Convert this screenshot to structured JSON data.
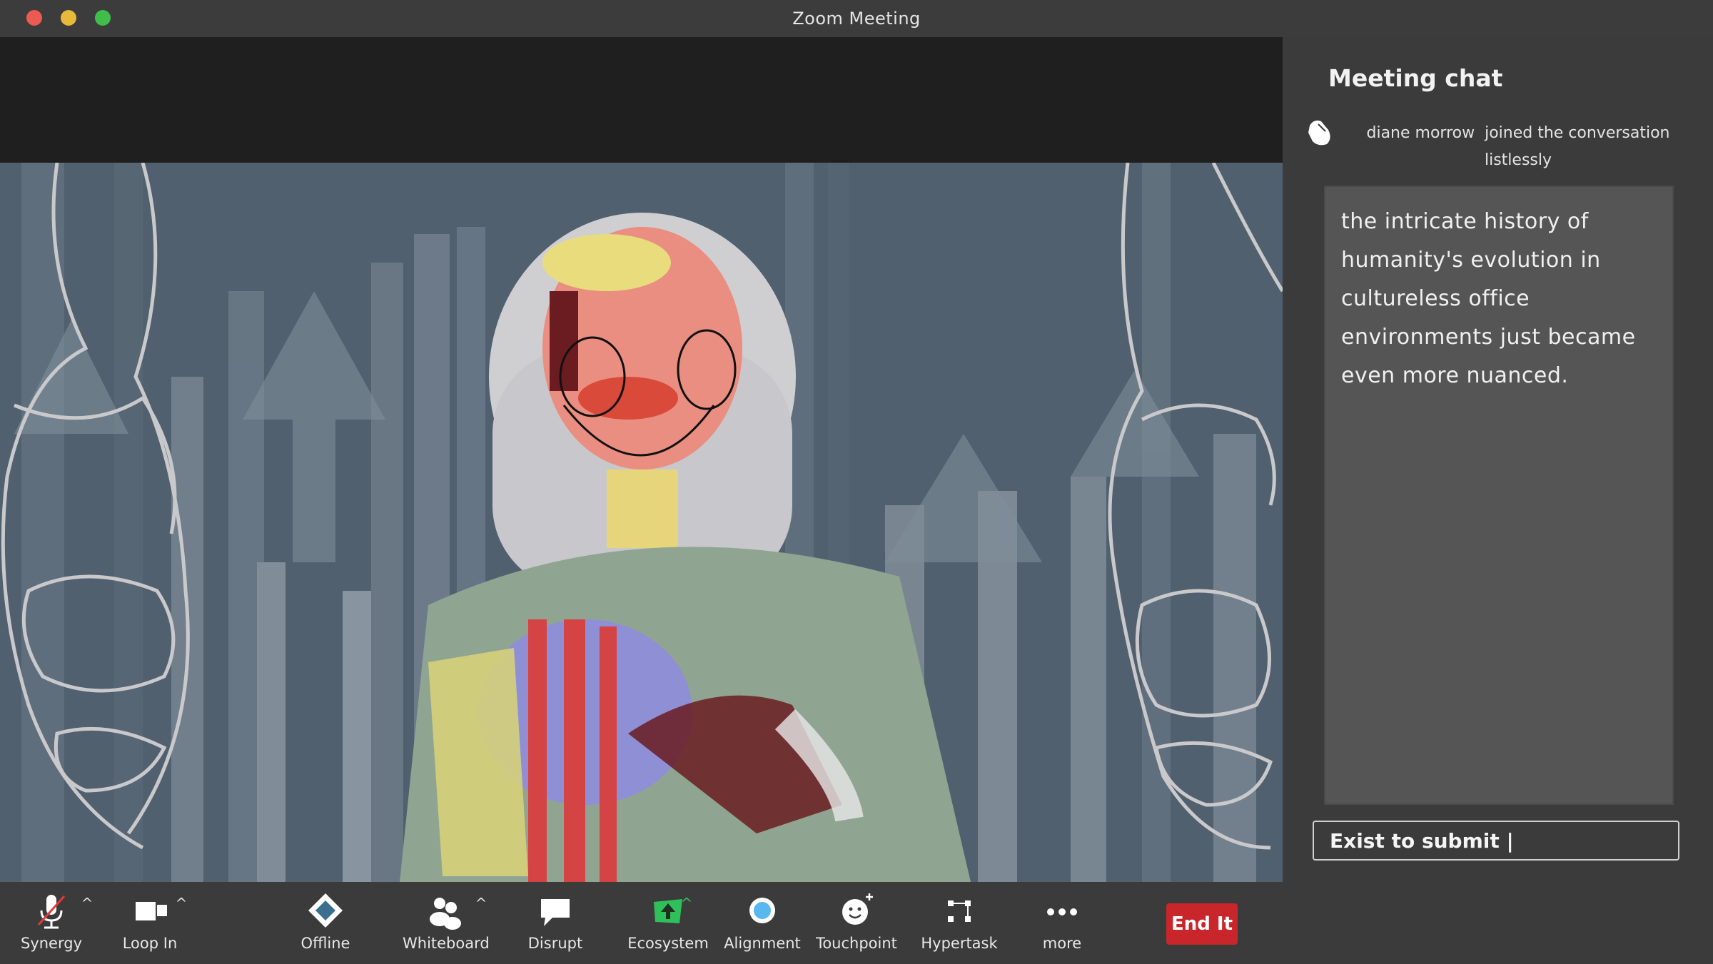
{
  "window": {
    "title": "Zoom Meeting"
  },
  "chat": {
    "title": "Meeting chat",
    "join_name": "diane morrow",
    "join_text": "joined the conversation listlessly",
    "message": "the intricate history of humanity's evolution in cultureless office environments just became even more nuanced.",
    "input_placeholder": "Exist to submit |"
  },
  "toolbar": {
    "synergy": "Synergy",
    "loop_in": "Loop In",
    "offline": "Offline",
    "whiteboard": "Whiteboard",
    "disrupt": "Disrupt",
    "ecosystem": "Ecosystem",
    "alignment": "Alignment",
    "touchpoint": "Touchpoint",
    "hypertask": "Hypertask",
    "more": "more",
    "end": "End It"
  },
  "colors": {
    "end_button": "#c8262b",
    "ecosystem_icon": "#2fbf5b",
    "alignment_icon": "#59b8f0"
  },
  "icons": {
    "synergy": "muted-microphone-icon",
    "loop_in": "video-camera-icon",
    "offline": "share-diamond-icon",
    "whiteboard": "participants-icon",
    "disrupt": "speech-bubble-icon",
    "ecosystem": "share-up-arrow-icon",
    "alignment": "record-circle-icon",
    "touchpoint": "smiley-plus-icon",
    "hypertask": "apps-icon",
    "more": "ellipsis-icon"
  }
}
